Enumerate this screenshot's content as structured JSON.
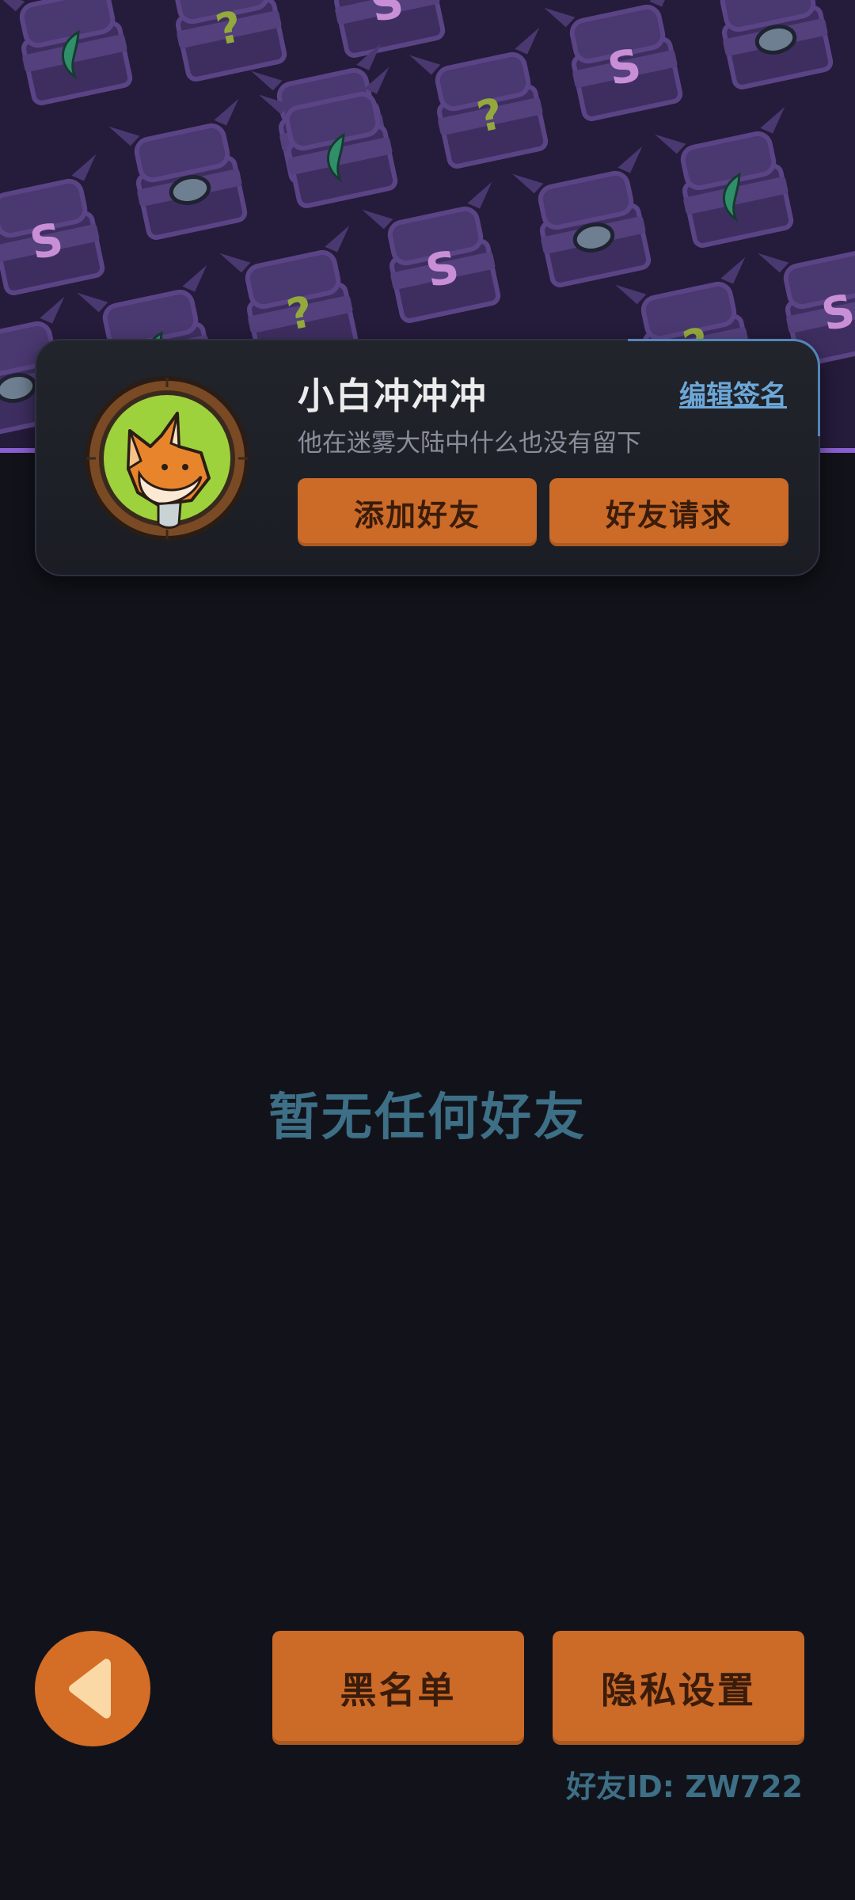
{
  "profile": {
    "nickname": "小白冲冲冲",
    "signature": "他在迷雾大陆中什么也没有留下",
    "edit_signature_label": "编辑签名",
    "add_friend_label": "添加好友",
    "friend_requests_label": "好友请求"
  },
  "main": {
    "empty_message": "暂无任何好友"
  },
  "footer": {
    "blacklist_label": "黑名单",
    "privacy_label": "隐私设置",
    "friend_id_text": "好友ID: ZW722"
  },
  "colors": {
    "background": "#12131a",
    "banner": "#251b3a",
    "accent_orange": "#cc6a28",
    "muted_teal": "#3d6f86",
    "link_blue": "#6ca7d8"
  },
  "icons": {
    "back": "left-triangle-icon",
    "avatar": "fox-avatar"
  }
}
